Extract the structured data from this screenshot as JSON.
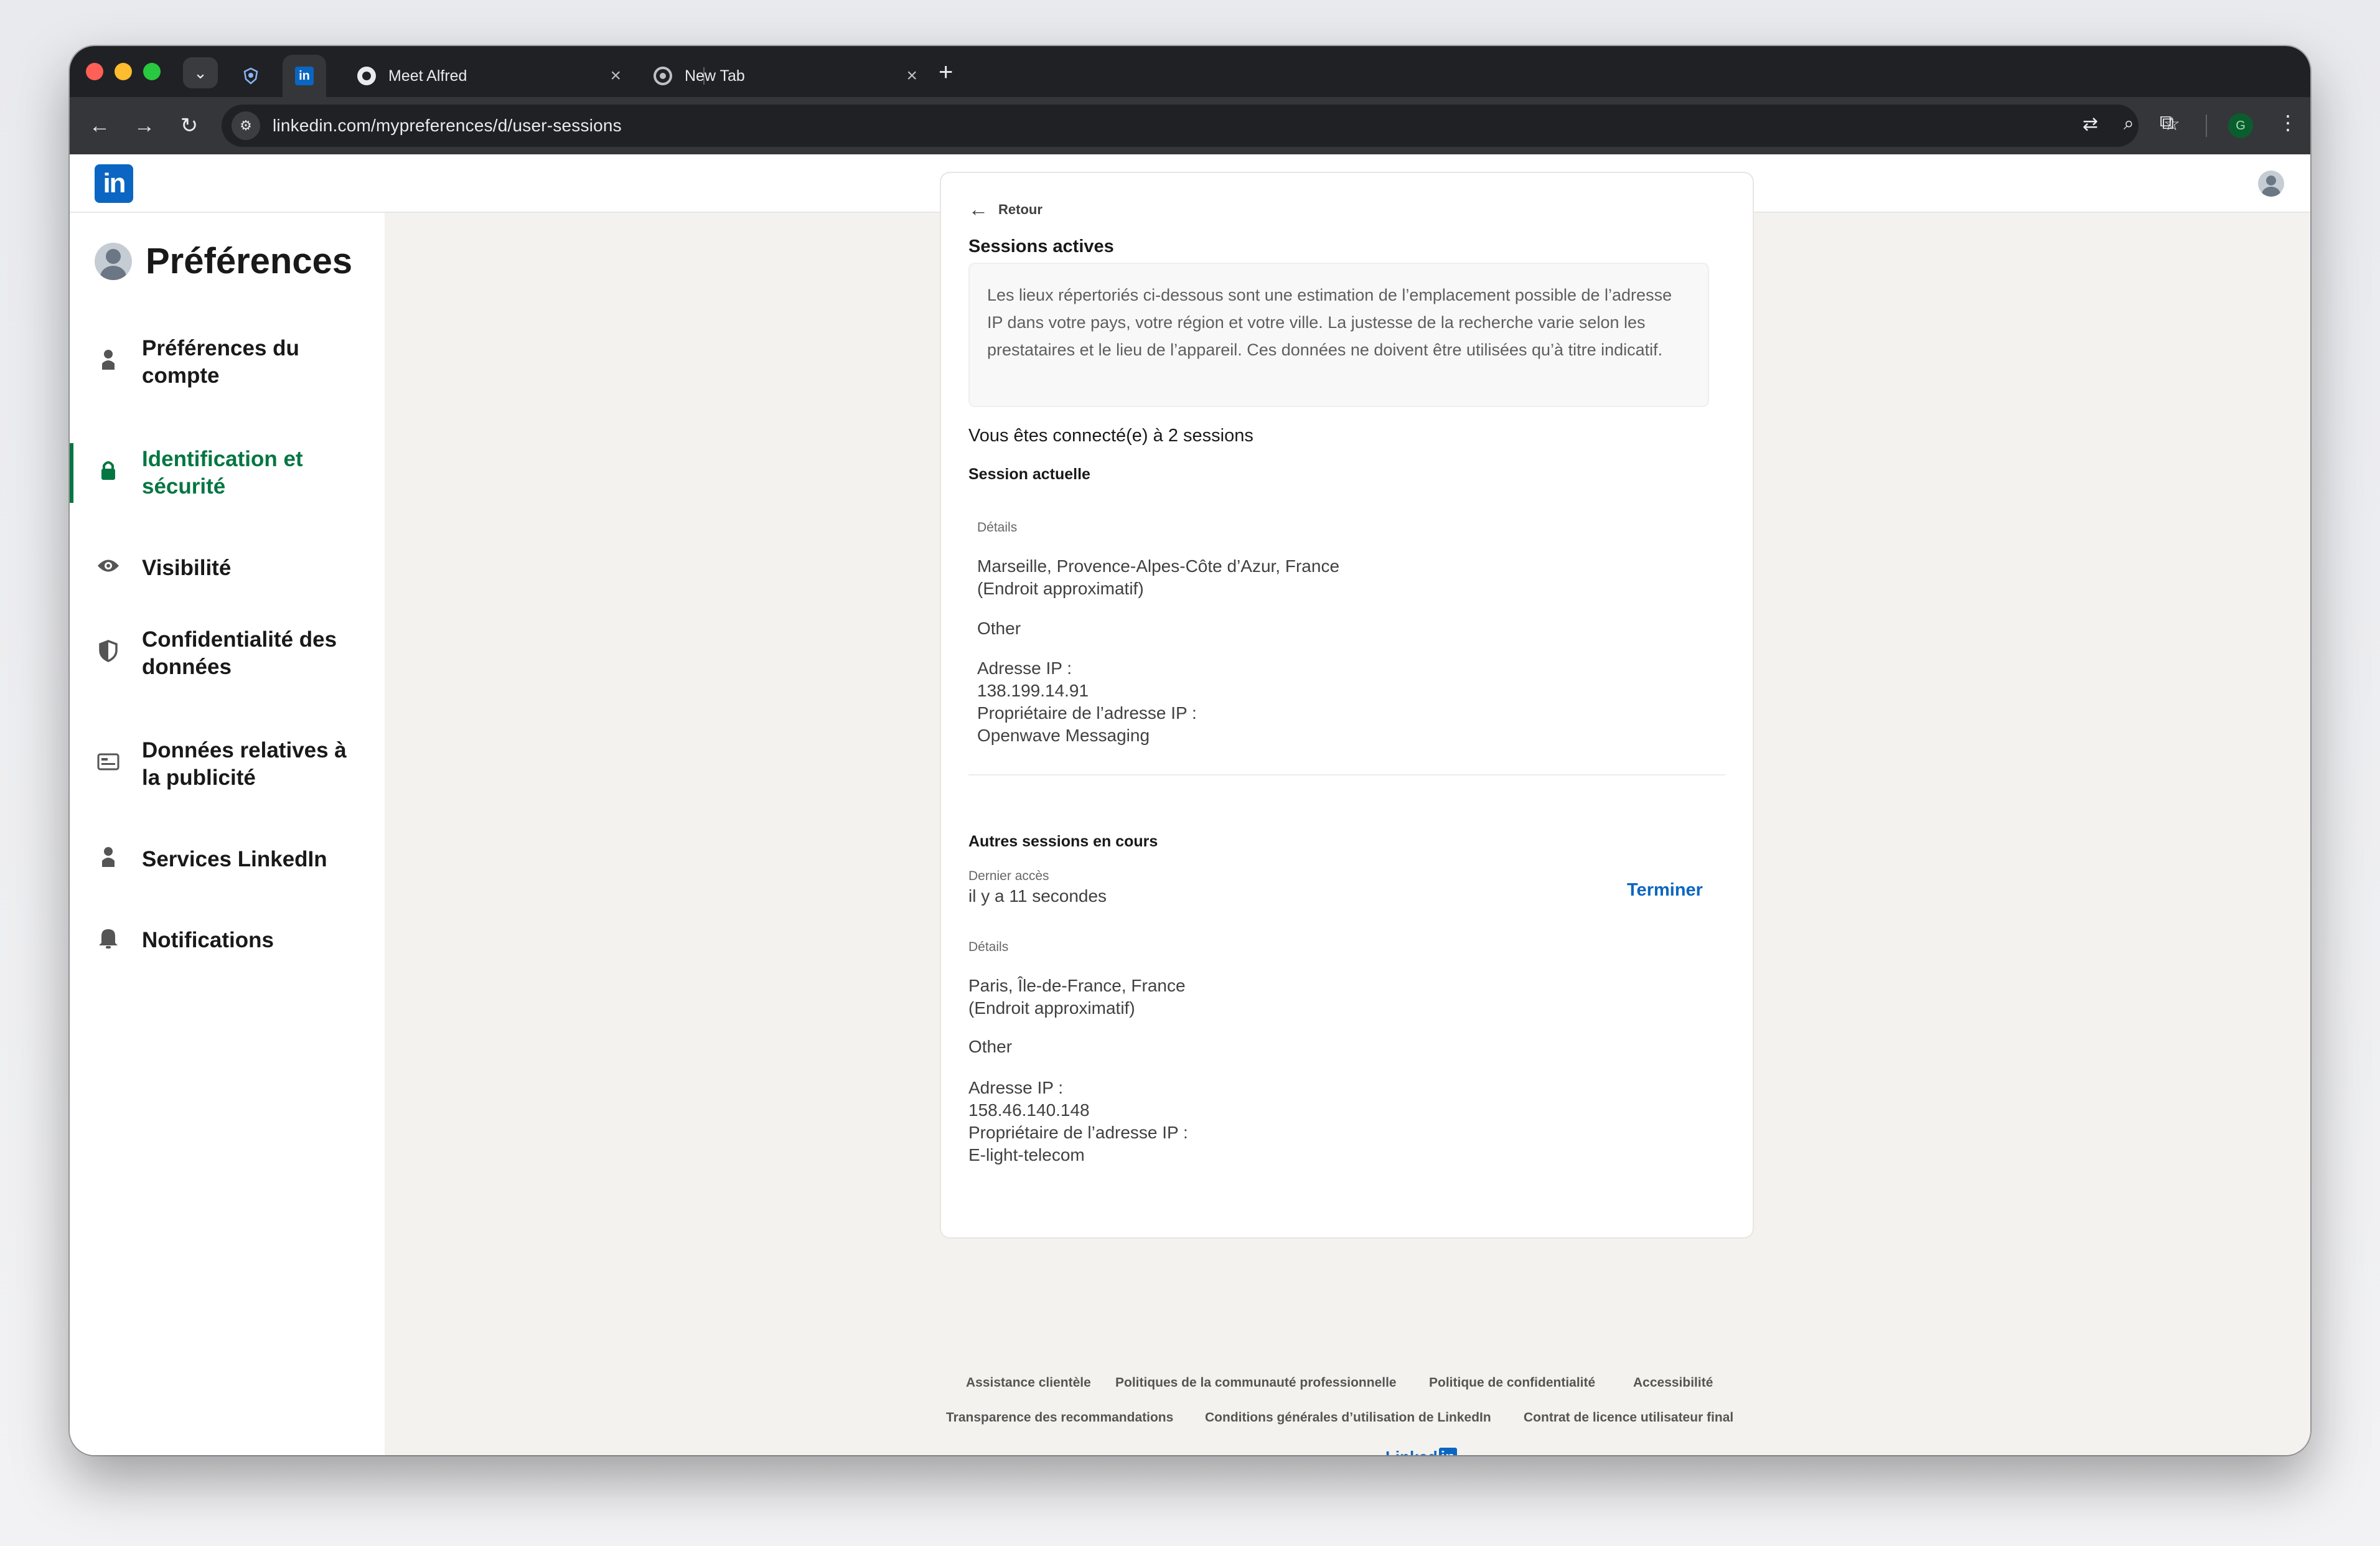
{
  "browser": {
    "tabs": [
      {
        "title": "Meet Alfred"
      },
      {
        "title": "New Tab"
      }
    ],
    "url": "linkedin.com/mypreferences/d/user-sessions",
    "profile_initial": "G"
  },
  "sidebar": {
    "title": "Préférences",
    "items": [
      {
        "label": "Préférences du compte",
        "icon": "person-icon"
      },
      {
        "label": "Identification et sécurité",
        "icon": "lock-icon",
        "active": true
      },
      {
        "label": "Visibilité",
        "icon": "eye-icon"
      },
      {
        "label": "Confidentialité des données",
        "icon": "shield-icon"
      },
      {
        "label": "Données relatives à la publicité",
        "icon": "ad-icon"
      },
      {
        "label": "Services LinkedIn",
        "icon": "person-icon"
      },
      {
        "label": "Notifications",
        "icon": "bell-icon"
      }
    ],
    "active_color": "#057642"
  },
  "main": {
    "back_label": "Retour",
    "heading": "Sessions actives",
    "info_text": "Les lieux répertoriés ci-dessous sont une estimation de l’emplacement possible de l’adresse IP dans votre pays, votre région et votre ville. La justesse de la recherche varie selon les prestataires et le lieu de l’appareil. Ces données ne doivent être utilisées qu’à titre indicatif.",
    "connected_count": "Vous êtes connecté(e) à 2 sessions",
    "current_session": {
      "heading": "Session actuelle",
      "details_label": "Détails",
      "location": "Marseille, Provence-Alpes-Côte d’Azur, France",
      "approx": "(Endroit approximatif)",
      "device": "Other",
      "ip_label": "Adresse IP :",
      "ip": "138.199.14.91",
      "owner_label": "Propriétaire de l’adresse IP :",
      "owner": "Openwave Messaging"
    },
    "other_sessions": {
      "heading": "Autres sessions en cours",
      "last_access_label": "Dernier accès",
      "last_access": "il y a 11 secondes",
      "end_button": "Terminer",
      "details_label": "Détails",
      "location": "Paris, Île-de-France, France",
      "approx": "(Endroit approximatif)",
      "device": "Other",
      "ip_label": "Adresse IP :",
      "ip": "158.46.140.148",
      "owner_label": "Propriétaire de l’adresse IP :",
      "owner": "E-light-telecom"
    }
  },
  "footer": {
    "links_row1": [
      "Assistance clientèle",
      "Politiques de la communauté professionnelle",
      "Politique de confidentialité",
      "Accessibilité"
    ],
    "links_row2": [
      "Transparence des recommandations",
      "Conditions générales d’utilisation de LinkedIn",
      "Contrat de licence utilisateur final"
    ],
    "logo_text": "Linked"
  },
  "colors": {
    "linkedin_blue": "#0a66c2",
    "page_bg": "#f4f2ee"
  }
}
